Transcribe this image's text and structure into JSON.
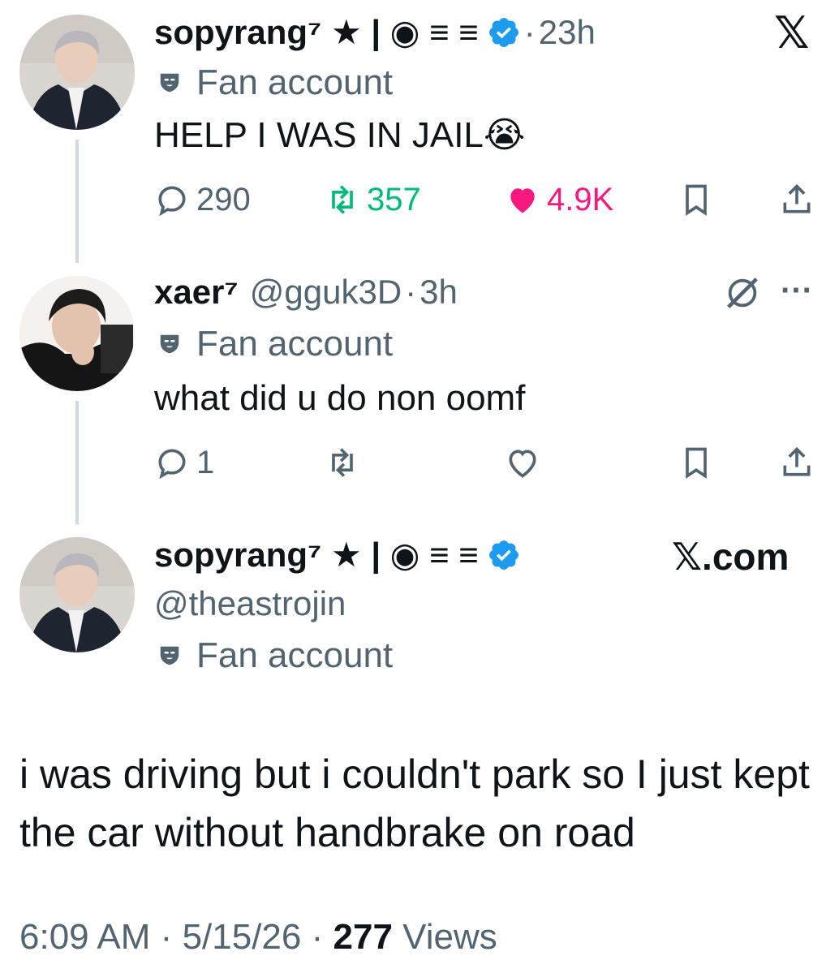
{
  "tweet1": {
    "display_name": "sopyrang⁷ ★ | ◉ ≡ ≡",
    "time": "23h",
    "label": "Fan account",
    "text": "HELP I WAS IN JAIL😭",
    "stats": {
      "replies": "290",
      "reposts": "357",
      "likes": "4.9K"
    },
    "colors": {
      "repost": "#00ba7c",
      "like": "#f91880",
      "verified": "#1d9bf0"
    }
  },
  "reply": {
    "display_name": "xaer⁷",
    "handle": "@gguk3D",
    "time": "3h",
    "label": "Fan account",
    "text": "what did u do non oomf",
    "stats": {
      "replies": "1"
    },
    "more_icon": "···"
  },
  "quoted": {
    "display_name": "sopyrang⁷ ★ | ◉ ≡ ≡",
    "handle": "@theastrojin",
    "label": "Fan account",
    "site": "𝕏.com",
    "text": "i was driving but i couldn't park so I just kept the car without handbrake on road",
    "time": "6:09 AM",
    "date": "5/15/26",
    "views_count": "277",
    "views_label": "Views"
  },
  "x_logo": "𝕏",
  "icons": [
    "x-logo-icon",
    "verified-badge-icon",
    "fan-mask-icon",
    "reply-icon",
    "repost-icon",
    "like-icon",
    "bookmark-icon",
    "share-icon",
    "grok-icon",
    "more-icon"
  ]
}
